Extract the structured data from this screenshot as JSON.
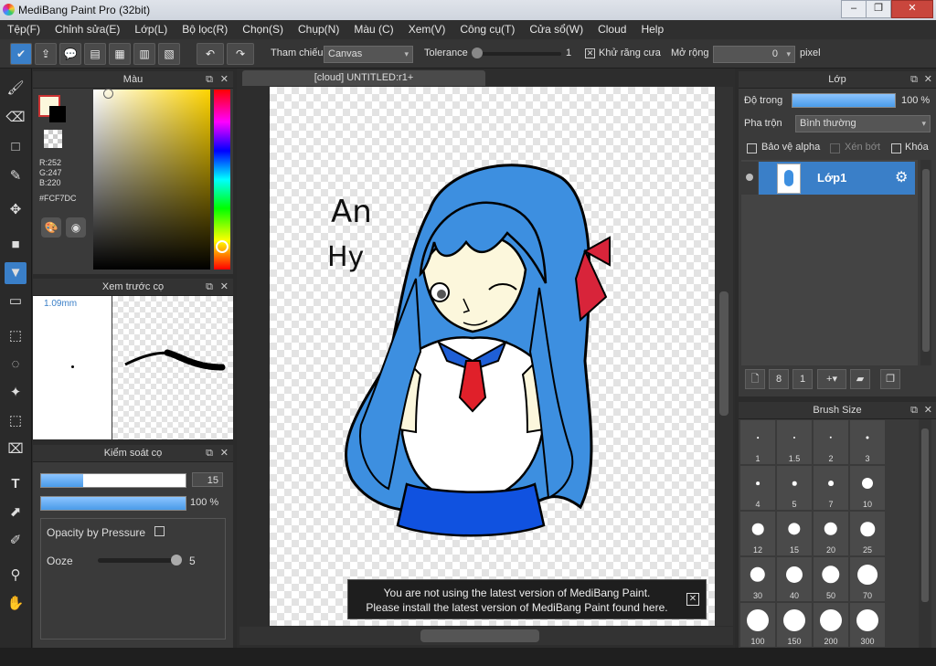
{
  "window": {
    "title": "MediBang Paint Pro (32bit)"
  },
  "menu": [
    "Tệp(F)",
    "Chỉnh sửa(E)",
    "Lớp(L)",
    "Bộ lọc(R)",
    "Chọn(S)",
    "Chụp(N)",
    "Màu (C)",
    "Xem(V)",
    "Công cụ(T)",
    "Cửa sổ(W)",
    "Cloud",
    "Help"
  ],
  "toolbar": {
    "reference_label": "Tham chiếu",
    "reference_value": "Canvas",
    "tolerance_label": "Tolerance",
    "tolerance_value": "1",
    "antialias_label": "Khử răng cưa",
    "expand_label": "Mở rộng",
    "expand_value": "0",
    "expand_unit": "pixel"
  },
  "color_panel": {
    "title": "Màu",
    "r": "R:252",
    "g": "G:247",
    "b": "B:220",
    "hex": "#FCF7DC",
    "current_color": "#FCF7DC"
  },
  "brush_preview": {
    "title": "Xem trước cọ",
    "size": "1.09mm"
  },
  "brush_control": {
    "title": "Kiểm soát cọ",
    "size_value": "15",
    "opacity_value": "100 %",
    "opacity_pressure_label": "Opacity by Pressure",
    "ooze_label": "Ooze",
    "ooze_value": "5"
  },
  "canvas": {
    "tab_label": "[cloud] UNTITLED:r1+",
    "drawing_text_1": "An",
    "drawing_text_2": "Hy"
  },
  "notice": {
    "line1": "You are not using the latest version of MediBang Paint.",
    "line2": "Please install the latest version of MediBang Paint found here."
  },
  "layer_panel": {
    "title": "Lớp",
    "opacity_label": "Độ trong",
    "opacity_value": "100 %",
    "blend_label": "Pha trộn",
    "blend_value": "Bình thường",
    "protect_alpha": "Bảo vệ alpha",
    "clipping": "Xén bớt",
    "lock": "Khóa",
    "layer_name": "Lớp1"
  },
  "brush_size_panel": {
    "title": "Brush Size",
    "sizes": [
      "1",
      "1.5",
      "2",
      "3",
      "4",
      "5",
      "7",
      "10",
      "12",
      "15",
      "20",
      "25",
      "30",
      "40",
      "50",
      "70",
      "100",
      "150",
      "200",
      "300"
    ]
  }
}
